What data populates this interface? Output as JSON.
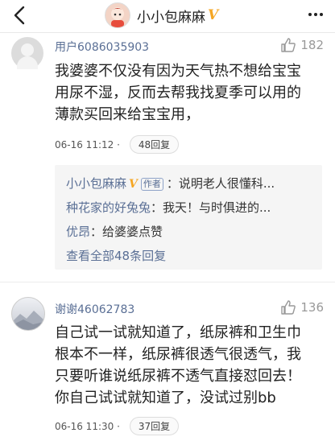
{
  "header": {
    "name": "小小包麻麻",
    "verified_badge": "V",
    "accent_color": "#f5a623",
    "icons": [
      "back-icon",
      "avatar",
      "more-icon"
    ]
  },
  "comments": [
    {
      "username": "用户6086035903",
      "likes": "182",
      "text_lines": [
        "我婆婆不仅没有因为天气热不想给宝宝",
        "用尿不湿，反而去帮我找夏季可以用的",
        "薄款买回来给宝宝用，"
      ],
      "time": "06-16 11:12 ·",
      "reply_count": "48回复"
    },
    {
      "username": "谢谢46062783",
      "likes": "136",
      "text_lines": [
        "自己试一试就知道了，纸尿裤和卫生巾",
        "根本不一样，纸尿裤很透气很透气，我",
        "只要听谁说纸尿裤不透气直接怼回去！",
        "你自己试试就知道了，没试过别bb"
      ],
      "time": "06-16 11:30 ·",
      "reply_count": "37回复"
    }
  ],
  "replies": [
    {
      "user": "小小包麻麻",
      "badge": "V",
      "tag": "作者",
      "text": "：说明老人很懂科..."
    },
    {
      "user": "种花家的好兔兔",
      "text": "：我天！与时俱进的..."
    },
    {
      "user": "优昂",
      "text": "：给婆婆点赞"
    }
  ],
  "view_all": "查看全部48条回复"
}
